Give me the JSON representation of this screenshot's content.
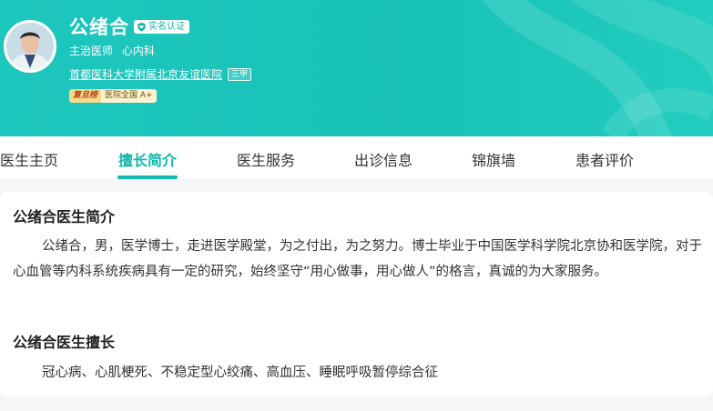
{
  "doctor": {
    "name": "公绪合",
    "verified_label": "实名认证",
    "title": "主治医师",
    "department": "心内科",
    "hospital": "首都医科大学附属北京友谊医院",
    "hospital_grade": "三甲",
    "rank_brand": "复旦榜",
    "rank_level": "医院全国 A+"
  },
  "tabs": [
    {
      "label": "医生主页",
      "active": false
    },
    {
      "label": "擅长简介",
      "active": true
    },
    {
      "label": "医生服务",
      "active": false
    },
    {
      "label": "出诊信息",
      "active": false
    },
    {
      "label": "锦旗墙",
      "active": false
    },
    {
      "label": "患者评价",
      "active": false
    }
  ],
  "intro": {
    "heading": "公绪合医生简介",
    "text": "公绪合，男，医学博士，走进医学殿堂，为之付出，为之努力。博士毕业于中国医学科学院北京协和医学院，对于心血管等内科系统疾病具有一定的研究，始终坚守“用心做事，用心做人”的格言，真诚的为大家服务。"
  },
  "expertise": {
    "heading": "公绪合医生擅长",
    "text": "冠心病、心肌梗死、不稳定型心绞痛、高血压、睡眠呼吸暂停综合征"
  },
  "colors": {
    "brand": "#19c2b7",
    "active_tab": "#12b8ad"
  }
}
